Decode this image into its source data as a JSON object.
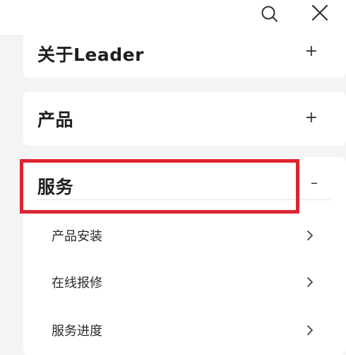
{
  "header": {
    "search_icon": "search-icon",
    "close_icon": "close-icon"
  },
  "menu": {
    "sections": [
      {
        "label": "关于Leader",
        "toggle": "+",
        "expanded": false
      },
      {
        "label": "产品",
        "toggle": "+",
        "expanded": false
      },
      {
        "label": "服务",
        "toggle": "–",
        "expanded": true,
        "items": [
          {
            "label": "产品安装"
          },
          {
            "label": "在线报修"
          },
          {
            "label": "服务进度"
          }
        ]
      }
    ]
  },
  "colors": {
    "highlight": "#de2430",
    "background": "#f4f4f4",
    "card": "#ffffff"
  }
}
